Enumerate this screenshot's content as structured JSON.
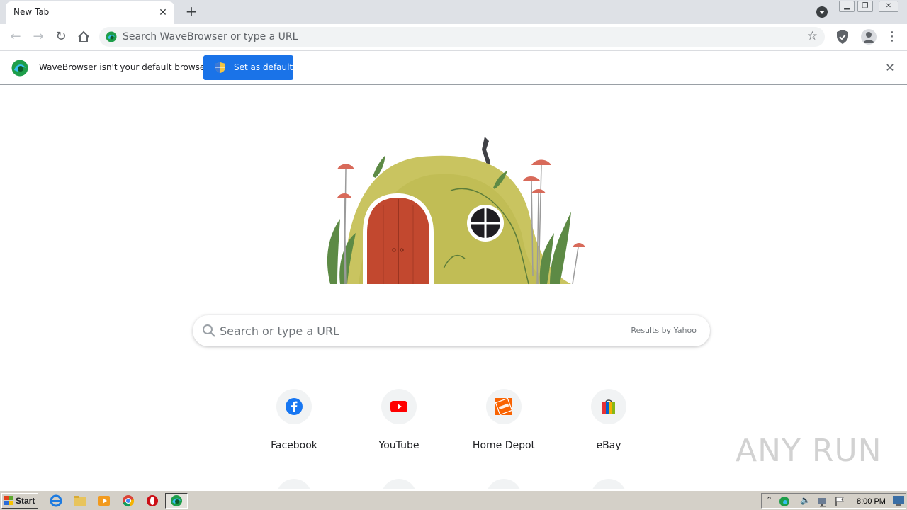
{
  "tabs": [
    {
      "title": "New Tab"
    }
  ],
  "toolbar": {
    "omnibox_placeholder": "Search WaveBrowser or type a URL"
  },
  "infobar": {
    "message": "WaveBrowser isn't your default browser",
    "button_label": "Set as default"
  },
  "search": {
    "placeholder": "Search or type a URL",
    "provider": "Results by Yahoo"
  },
  "shortcuts": [
    {
      "label": "Facebook",
      "icon": "facebook-icon"
    },
    {
      "label": "YouTube",
      "icon": "youtube-icon"
    },
    {
      "label": "Home Depot",
      "icon": "home-depot-icon"
    },
    {
      "label": "eBay",
      "icon": "ebay-icon"
    }
  ],
  "watermark": "ANY RUN",
  "taskbar": {
    "start_label": "Start",
    "clock": "8:00 PM"
  },
  "colors": {
    "accent": "#1a73e8",
    "tabstrip": "#dee1e6",
    "taskbar": "#d4d0c8"
  }
}
